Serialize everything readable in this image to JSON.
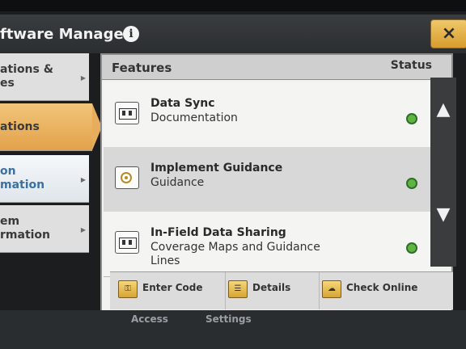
{
  "title": "ftware Manager",
  "sidebar": [
    {
      "label": "ations &\nes"
    },
    {
      "label": "ations"
    },
    {
      "label": "on\nmation"
    },
    {
      "label": "em\nrmation"
    }
  ],
  "table": {
    "col_features": "Features",
    "col_status": "Status"
  },
  "features": [
    {
      "name": "Data Sync",
      "sub": "Documentation"
    },
    {
      "name": "Implement Guidance",
      "sub": "Guidance"
    },
    {
      "name": "In-Field Data Sharing",
      "sub": "Coverage Maps and Guidance Lines"
    }
  ],
  "footer": [
    {
      "label": "Enter Code"
    },
    {
      "label": "Details"
    },
    {
      "label": "Check Online"
    }
  ],
  "partial_bottom": [
    "Access",
    "Settings"
  ],
  "icons": {
    "close": "×",
    "info": "i",
    "up": "▲",
    "down": "▼",
    "side_arrow": "▶"
  }
}
